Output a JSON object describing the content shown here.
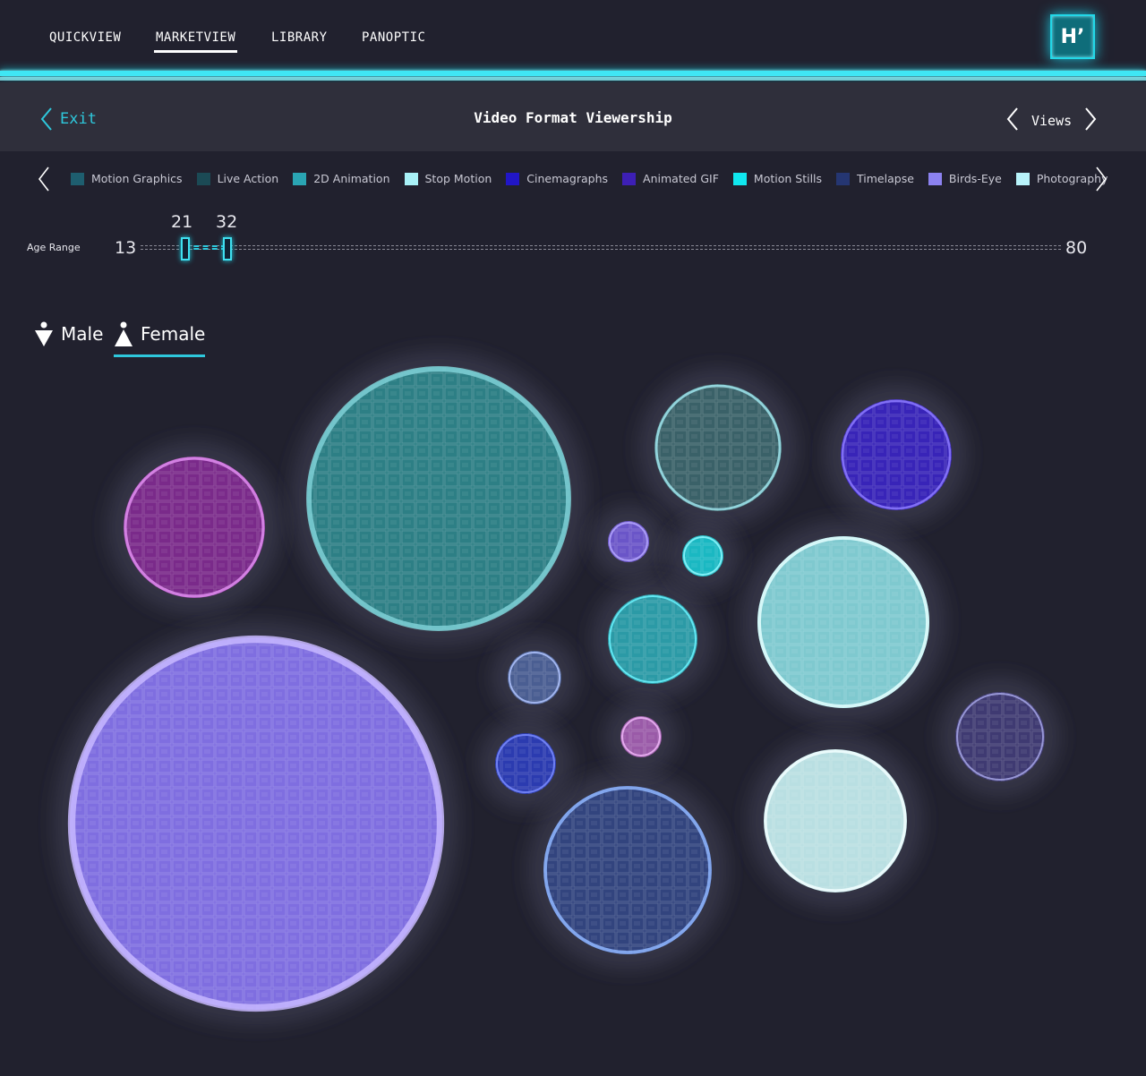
{
  "nav": {
    "items": [
      {
        "label": "QUICKVIEW"
      },
      {
        "label": "MARKETVIEW"
      },
      {
        "label": "LIBRARY"
      },
      {
        "label": "PANOPTIC"
      }
    ],
    "active": "MARKETVIEW",
    "logo": "H’"
  },
  "header": {
    "exit_label": "Exit",
    "title": "Video Format Viewership",
    "views_label": "Views"
  },
  "legend": {
    "items": [
      {
        "label": "Motion Graphics",
        "color": "#1e5e6f"
      },
      {
        "label": "Live Action",
        "color": "#1b4a55"
      },
      {
        "label": "2D Animation",
        "color": "#2aa5b3"
      },
      {
        "label": "Stop Motion",
        "color": "#a8f1f7"
      },
      {
        "label": "Cinemagraphs",
        "color": "#2116c7"
      },
      {
        "label": "Animated GIF",
        "color": "#3d1fb5"
      },
      {
        "label": "Motion Stills",
        "color": "#10e8ef"
      },
      {
        "label": "Timelapse",
        "color": "#253672"
      },
      {
        "label": "Birds-Eye",
        "color": "#8c82f0"
      },
      {
        "label": "Photography",
        "color": "#b8f3fa"
      }
    ]
  },
  "age_range": {
    "label": "Age  Range",
    "min": "13",
    "max": "80",
    "low": "21",
    "high": "32"
  },
  "gender": {
    "male_label": "Male",
    "female_label": "Female",
    "active": "Female"
  },
  "bubbles": [
    {
      "name": "bubble-birds-eye-large",
      "color": "#7f6ee0",
      "rim": "#c8b8ff"
    },
    {
      "name": "bubble-2d-animation-large",
      "color": "#2d7f85",
      "rim": "#7fd0d6"
    },
    {
      "name": "bubble-animated-gif-magenta",
      "color": "#7a2a8a",
      "rim": "#e08df0"
    },
    {
      "name": "bubble-live-action",
      "color": "#3a6168",
      "rim": "#a0e6ee"
    },
    {
      "name": "bubble-cinemagraphs",
      "color": "#3824b8",
      "rim": "#8c7aff"
    },
    {
      "name": "bubble-stop-motion",
      "color": "#7fc9cf",
      "rim": "#e4ffff"
    },
    {
      "name": "bubble-timelapse",
      "color": "#32447e",
      "rim": "#8fb6ff"
    },
    {
      "name": "bubble-photography",
      "color": "#b9dfe2",
      "rim": "#f2ffff"
    },
    {
      "name": "bubble-motion-graphics",
      "color": "#2b9aa6",
      "rim": "#6af3ff"
    },
    {
      "name": "bubble-small-purple-right",
      "color": "#3f3a72",
      "rim": "#a6a6e6"
    },
    {
      "name": "bubble-small-violet",
      "color": "#6a55c8",
      "rim": "#b4a6ff"
    },
    {
      "name": "bubble-motion-stills",
      "color": "#1ab8c2",
      "rim": "#8ff8ff"
    },
    {
      "name": "bubble-small-slate",
      "color": "#4a5e92",
      "rim": "#b0c4ff"
    },
    {
      "name": "bubble-small-navy",
      "color": "#2b3bb0",
      "rim": "#7a8cff"
    },
    {
      "name": "bubble-small-pink",
      "color": "#9a5aa8",
      "rim": "#f0b6f8"
    }
  ]
}
